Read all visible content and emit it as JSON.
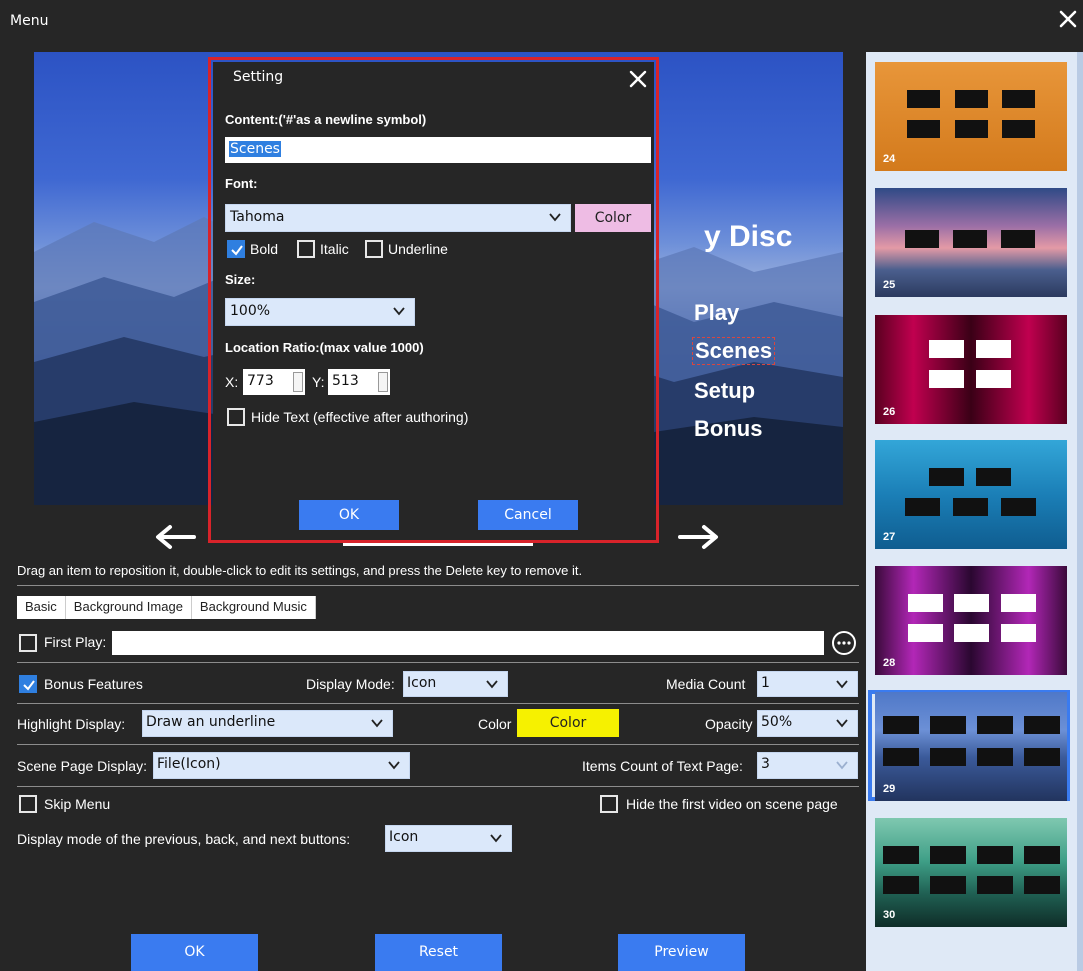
{
  "window": {
    "title": "Menu"
  },
  "preview": {
    "menu_title": "y Disc",
    "menu_items": [
      "Play",
      "Scenes",
      "Setup",
      "Bonus"
    ]
  },
  "dialog": {
    "title": "Setting",
    "content_label": "Content:('#'as a newline symbol)",
    "content_value": "Scenes",
    "font_label": "Font:",
    "font_value": "Tahoma",
    "color_label": "Color",
    "bold": {
      "label": "Bold",
      "checked": true
    },
    "italic": {
      "label": "Italic",
      "checked": false
    },
    "underline": {
      "label": "Underline",
      "checked": false
    },
    "size_label": "Size:",
    "size_value": "100%",
    "location_label": "Location Ratio:(max value 1000)",
    "x_label": "X:",
    "x_value": "773",
    "y_label": "Y:",
    "y_value": "513",
    "hide_text": {
      "label": "Hide Text (effective after authoring)",
      "checked": false
    },
    "ok_label": "OK",
    "cancel_label": "Cancel"
  },
  "hint": "Drag an item to reposition it, double-click to edit its settings, and press the Delete key to remove it.",
  "tabs": [
    "Basic",
    "Background Image",
    "Background Music"
  ],
  "basic": {
    "first_play": {
      "label": "First Play:",
      "checked": false,
      "value": ""
    },
    "bonus_features": {
      "label": "Bonus Features",
      "checked": true
    },
    "display_mode_label": "Display Mode:",
    "display_mode_value": "Icon",
    "media_count_label": "Media Count",
    "media_count_value": "1",
    "highlight_label": "Highlight Display:",
    "highlight_value": "Draw an underline",
    "color_label": "Color",
    "color_button": "Color",
    "opacity_label": "Opacity",
    "opacity_value": "50%",
    "scene_page_label": "Scene Page Display:",
    "scene_page_value": "File(Icon)",
    "items_count_label": "Items Count of Text Page:",
    "items_count_value": "3",
    "skip_menu": {
      "label": "Skip Menu",
      "checked": false
    },
    "hide_first_video": {
      "label": "Hide the first video on scene page",
      "checked": false
    },
    "nav_buttons_label": "Display mode of the previous, back, and next buttons:",
    "nav_buttons_value": "Icon"
  },
  "footer": {
    "ok": "OK",
    "reset": "Reset",
    "preview": "Preview"
  },
  "templates": [
    {
      "number": "24"
    },
    {
      "number": "25"
    },
    {
      "number": "26"
    },
    {
      "number": "27"
    },
    {
      "number": "28"
    },
    {
      "number": "29"
    },
    {
      "number": "30"
    }
  ],
  "colors": {
    "accent": "#3a7bf0",
    "highlight_color": "#f6f100",
    "dialog_border": "#d8232a",
    "font_color_button": "#eebce4"
  }
}
